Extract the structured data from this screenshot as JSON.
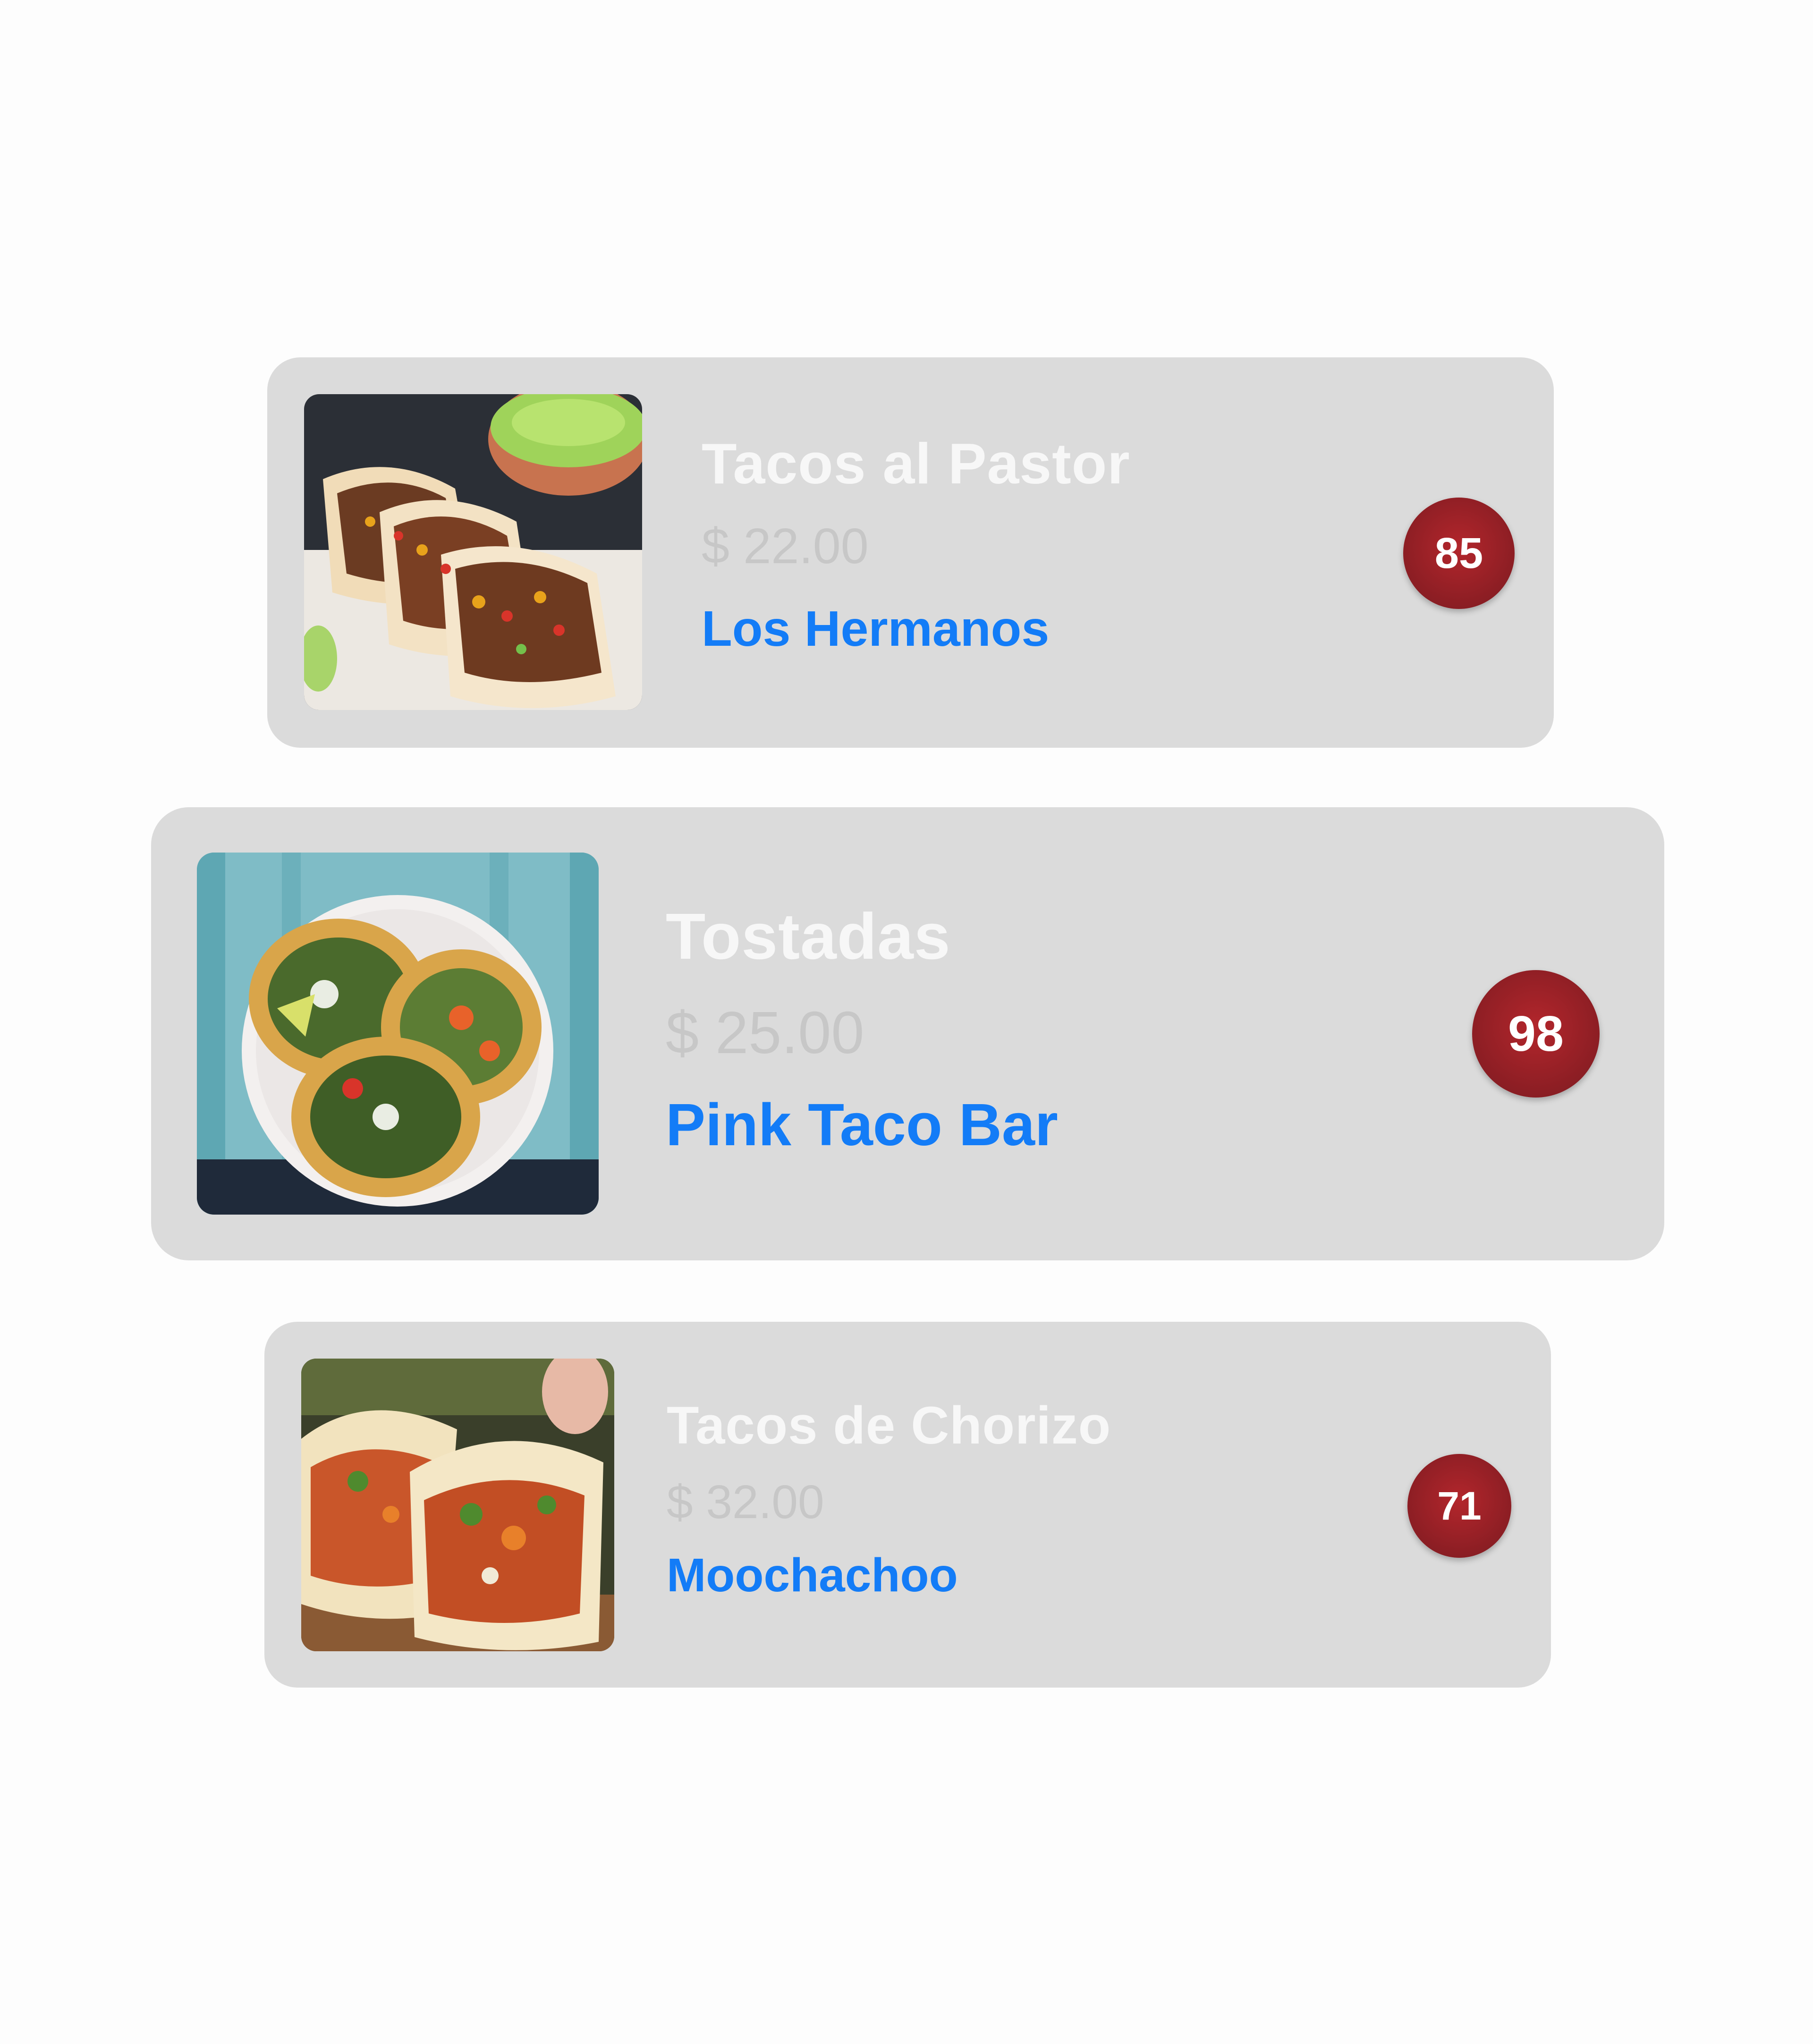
{
  "items": [
    {
      "name": "Tacos al Pastor",
      "price": "$ 22.00",
      "restaurant": "Los Hermanos",
      "score": "85"
    },
    {
      "name": "Tostadas",
      "price": "$ 25.00",
      "restaurant": "Pink Taco Bar",
      "score": "98"
    },
    {
      "name": "Tacos de Chorizo",
      "price": "$ 32.00",
      "restaurant": "Moochachoo",
      "score": "71"
    }
  ],
  "colors": {
    "card_background": "#dbdbdb",
    "item_name": "#f7f7f7",
    "price": "#c7c7c7",
    "restaurant_link": "#137cf7",
    "score_badge": "#8a1c22"
  }
}
